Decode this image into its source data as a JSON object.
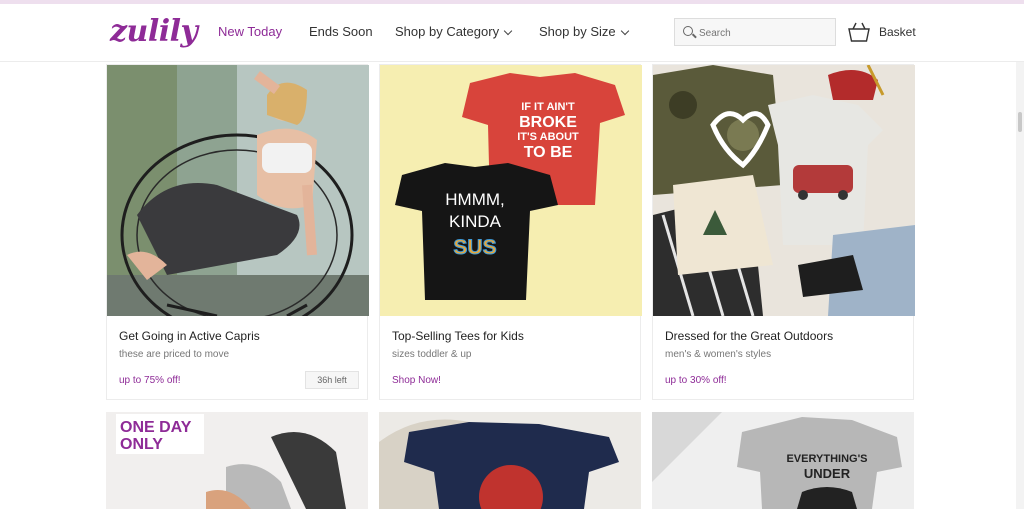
{
  "brand": {
    "logo_text": "zulily",
    "accent_color": "#8e2b97"
  },
  "nav": {
    "new_today": "New Today",
    "ends_soon": "Ends Soon",
    "shop_by_category": "Shop by Category",
    "shop_by_size": "Shop by Size"
  },
  "search": {
    "placeholder": "Search"
  },
  "basket": {
    "label": "Basket"
  },
  "events": [
    {
      "title": "Get Going in Active Capris",
      "subtitle": "these are priced to move",
      "promo": "up to 75% off!",
      "time_left": "36h left"
    },
    {
      "title": "Top-Selling Tees for Kids",
      "subtitle": "sizes toddler & up",
      "promo": "Shop Now!"
    },
    {
      "title": "Dressed for the Great Outdoors",
      "subtitle": "men's & women's styles",
      "promo": "up to 30% off!"
    }
  ],
  "images": {
    "tee_red_text_1": "IF IT AIN'T",
    "tee_red_text_2": "BROKE",
    "tee_red_text_3": "IT'S ABOUT",
    "tee_red_text_4": "TO BE",
    "tee_black_text_1": "HMMM,",
    "tee_black_text_2": "KINDA",
    "tee_black_text_3": "SUS",
    "one_day_badge_1": "ONE DAY",
    "one_day_badge_2": "ONLY",
    "grey_tee_text_1": "EVERYTHING'S",
    "grey_tee_text_2": "UNDER"
  }
}
